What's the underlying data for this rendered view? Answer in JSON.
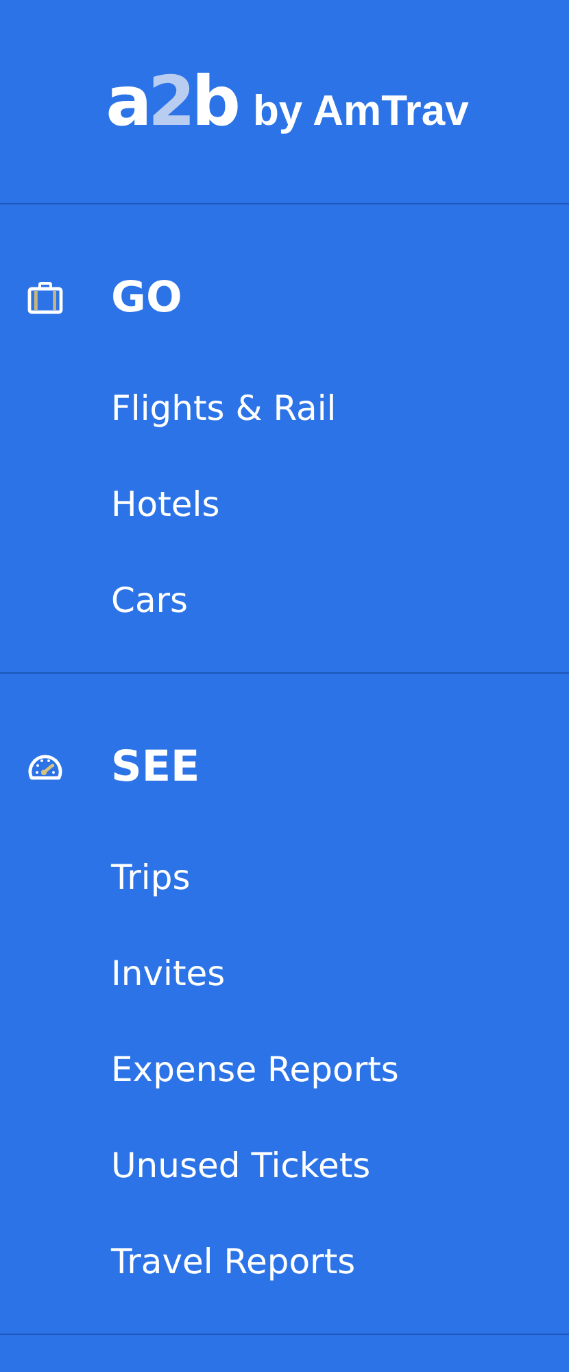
{
  "logo": {
    "mark": "a2b",
    "text": "by AmTrav"
  },
  "sections": [
    {
      "title": "GO",
      "items": [
        "Flights & Rail",
        "Hotels",
        "Cars"
      ]
    },
    {
      "title": "SEE",
      "items": [
        "Trips",
        "Invites",
        "Expense Reports",
        "Unused Tickets",
        "Travel Reports"
      ]
    }
  ]
}
